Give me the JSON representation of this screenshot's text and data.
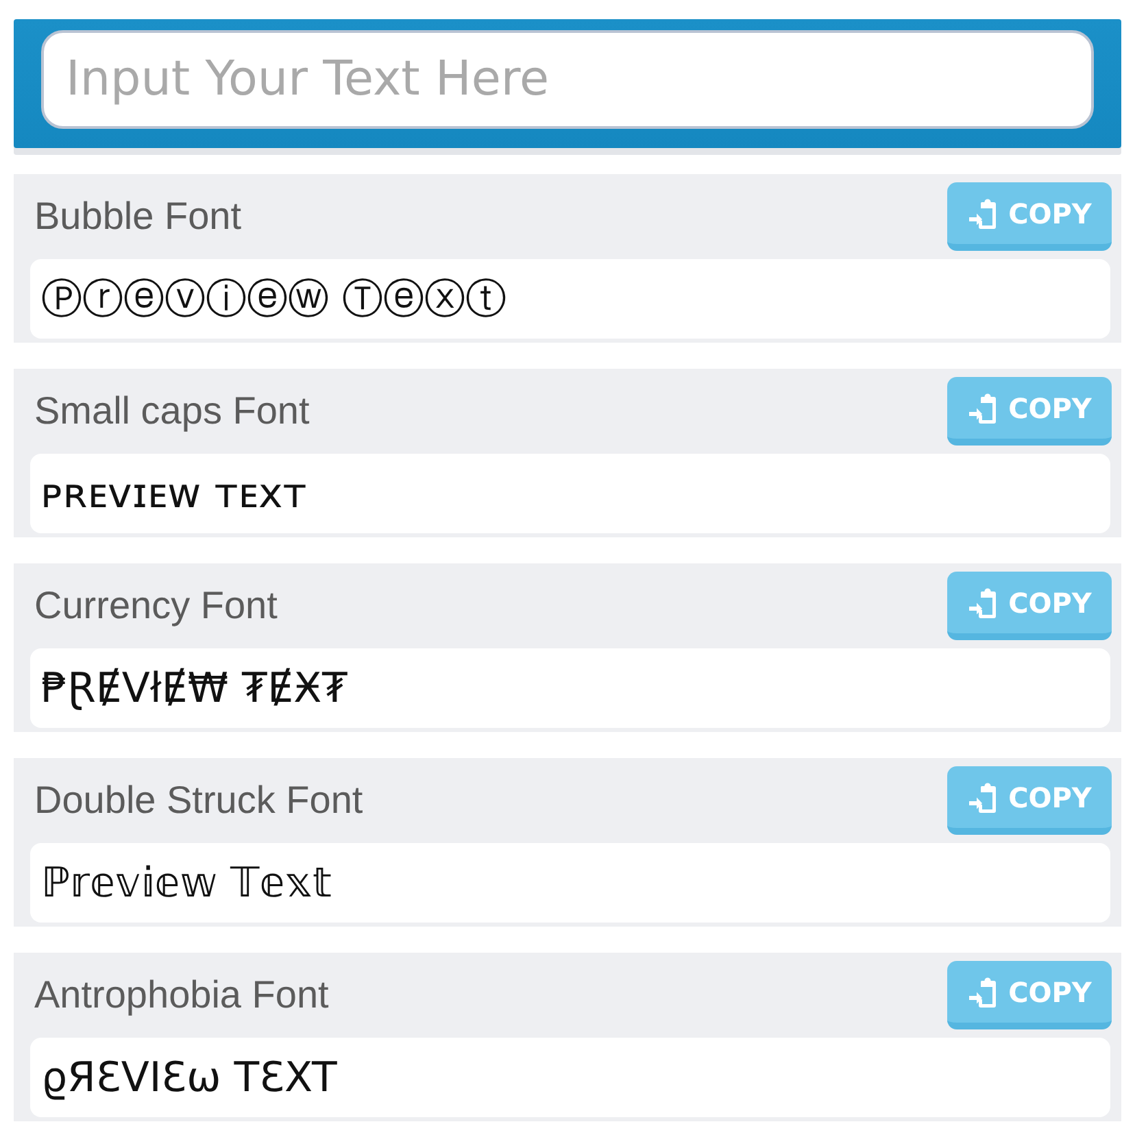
{
  "input": {
    "placeholder": "Input Your Text Here"
  },
  "fonts": [
    {
      "name": "Bubble Font",
      "button": "COPY",
      "preview": "Ⓟⓡⓔⓥⓘⓔⓦ Ⓣⓔⓧⓣ"
    },
    {
      "name": "Small caps Font",
      "button": "COPY",
      "preview": "ᴘʀᴇᴠɪᴇᴡ ᴛᴇxᴛ"
    },
    {
      "name": "Currency Font",
      "button": "COPY",
      "preview": "₱ⱤɆVłɆ₩ ₮ɆӾ₮"
    },
    {
      "name": "Double Struck Font",
      "button": "COPY",
      "preview": "ℙ𝕣𝕖𝕧𝕚𝕖𝕨 𝕋𝕖𝕩𝕥"
    },
    {
      "name": "Antrophobia Font",
      "button": "COPY",
      "preview": "ϱЯƐVIƐω TƐXT"
    }
  ]
}
